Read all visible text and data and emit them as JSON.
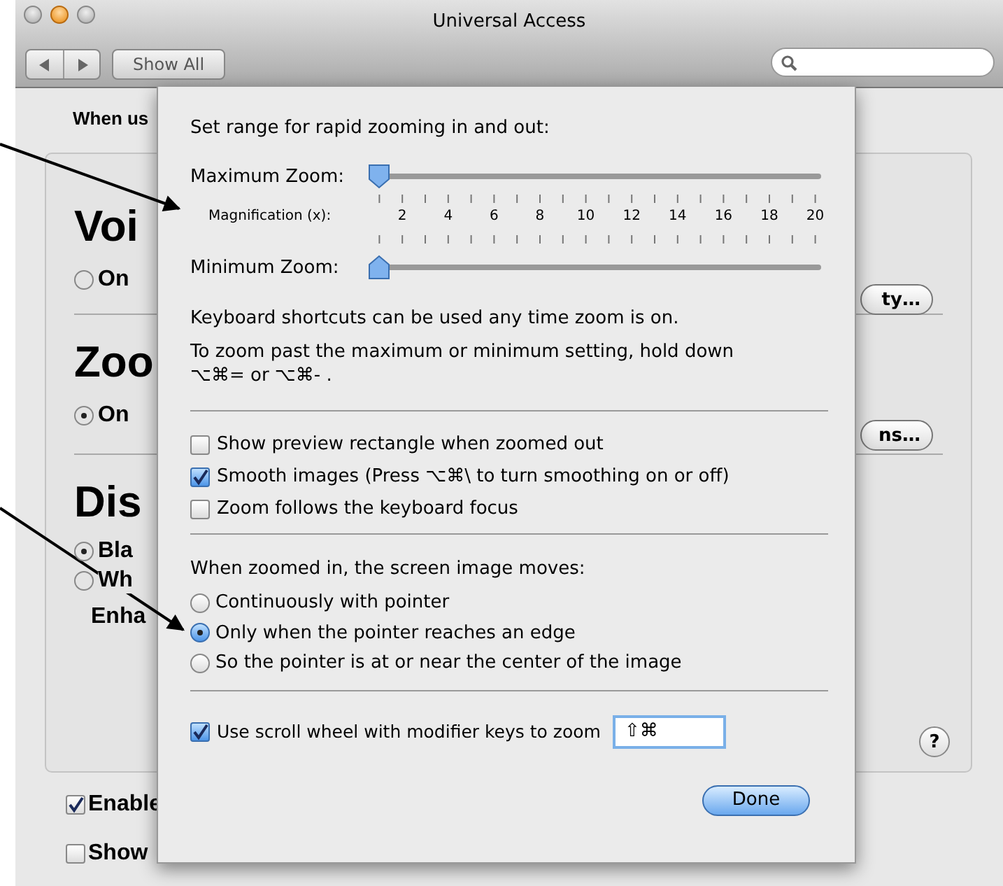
{
  "window": {
    "title": "Universal Access"
  },
  "toolbar": {
    "show_all": "Show All"
  },
  "background": {
    "prompt": "When us",
    "sections": [
      {
        "title": "Voi",
        "options": [
          {
            "label": "On",
            "selected": false
          }
        ],
        "button": "ty…"
      },
      {
        "title": "Zoo",
        "options": [
          {
            "label": "On",
            "selected": true
          }
        ],
        "button": "ns…"
      },
      {
        "title": "Dis",
        "options": [
          {
            "label": "Bla",
            "selected": true
          },
          {
            "label": "Wh",
            "selected": false
          }
        ],
        "note": "Enha"
      }
    ],
    "help": "?",
    "checks": [
      {
        "label": "Enable",
        "checked": true
      },
      {
        "label": "Show",
        "checked": false
      }
    ]
  },
  "sheet": {
    "intro": "Set range for rapid zooming in and out:",
    "sliders": [
      {
        "label": "Maximum Zoom:",
        "level": 0
      },
      {
        "label": "Minimum Zoom:",
        "level": 0
      }
    ],
    "scale": {
      "label": "Magnification (x):",
      "ticks": [
        "2",
        "4",
        "6",
        "8",
        "10",
        "12",
        "14",
        "16",
        "18",
        "20"
      ]
    },
    "shortcut_note": "Keyboard shortcuts can be used any time zoom is on.",
    "hold_note": "To zoom past the maximum or minimum setting, hold down\n⌥⌘= or ⌥⌘- .",
    "checkboxes": [
      {
        "label": "Show preview rectangle when zoomed out",
        "checked": false
      },
      {
        "label": "Smooth images (Press ⌥⌘\\ to turn smoothing on or off)",
        "checked": true
      },
      {
        "label": "Zoom follows the keyboard focus",
        "checked": false
      }
    ],
    "moves_label": "When zoomed in, the screen image moves:",
    "radios": [
      {
        "label": "Continuously with pointer",
        "selected": false
      },
      {
        "label": "Only when the pointer reaches an edge",
        "selected": true
      },
      {
        "label": "So the pointer is at or near the center of the image",
        "selected": false
      }
    ],
    "scroll": {
      "label": "Use scroll wheel with modifier keys to zoom",
      "checked": true,
      "value": "⇧⌘"
    },
    "done": "Done"
  }
}
